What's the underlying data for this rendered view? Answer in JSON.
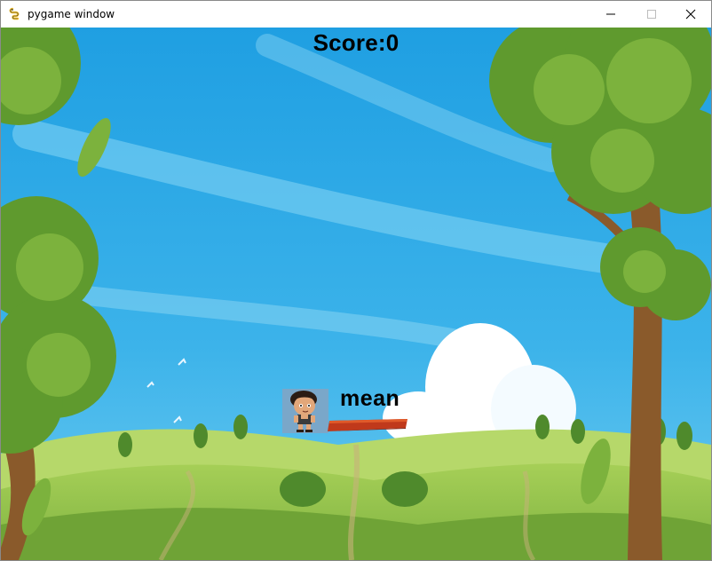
{
  "window": {
    "title": "pygame window",
    "controls": {
      "minimize": "minimize-icon",
      "maximize": "maximize-icon",
      "close": "close-icon"
    }
  },
  "game": {
    "score_label": "Score:0",
    "word": "mean"
  },
  "colors": {
    "sky": "#2fa8e4",
    "grass": "#8bc34a",
    "platform": "#c0391b",
    "text": "#000000"
  }
}
